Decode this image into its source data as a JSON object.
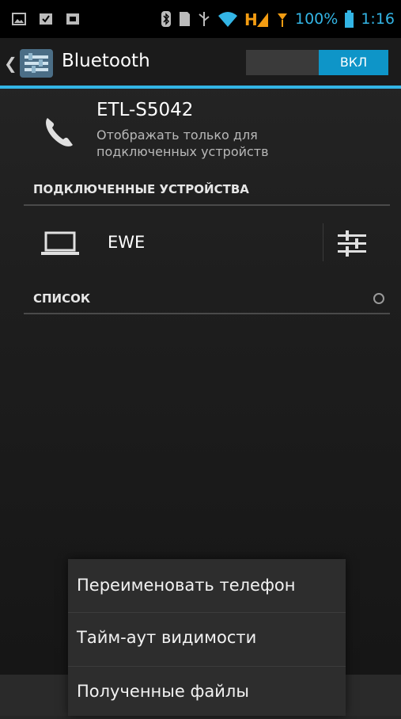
{
  "status_bar": {
    "battery_percent": "100%",
    "time": "1:16",
    "network_label": "H",
    "accent_color": "#33b5e5",
    "icons": [
      "gallery-icon",
      "checklist-icon",
      "video-icon",
      "bluetooth-icon",
      "sd-card-icon",
      "usb-icon",
      "wifi-icon",
      "data-signal-icon",
      "signal-icon",
      "battery-icon"
    ]
  },
  "action_bar": {
    "title": "Bluetooth",
    "toggle_state": "ВКЛ",
    "accent_color": "#0e95c8"
  },
  "device": {
    "name": "ETL-S5042",
    "visibility_text": "Отображать только для подключенных устройств",
    "icon": "phone-icon"
  },
  "paired_section": {
    "header": "ПОДКЛЮЧЕННЫЕ УСТРОЙСТВА",
    "devices": [
      {
        "name": "EWE",
        "icon": "laptop-icon",
        "settings_icon": "settings-sliders-icon"
      }
    ]
  },
  "available_section": {
    "header": "СПИСОК",
    "scanning_icon": "progress-spinner-icon"
  },
  "overflow_menu": {
    "items": [
      {
        "label": "Переименовать телефон"
      },
      {
        "label": "Тайм-аут видимости"
      },
      {
        "label": "Полученные файлы"
      }
    ]
  }
}
